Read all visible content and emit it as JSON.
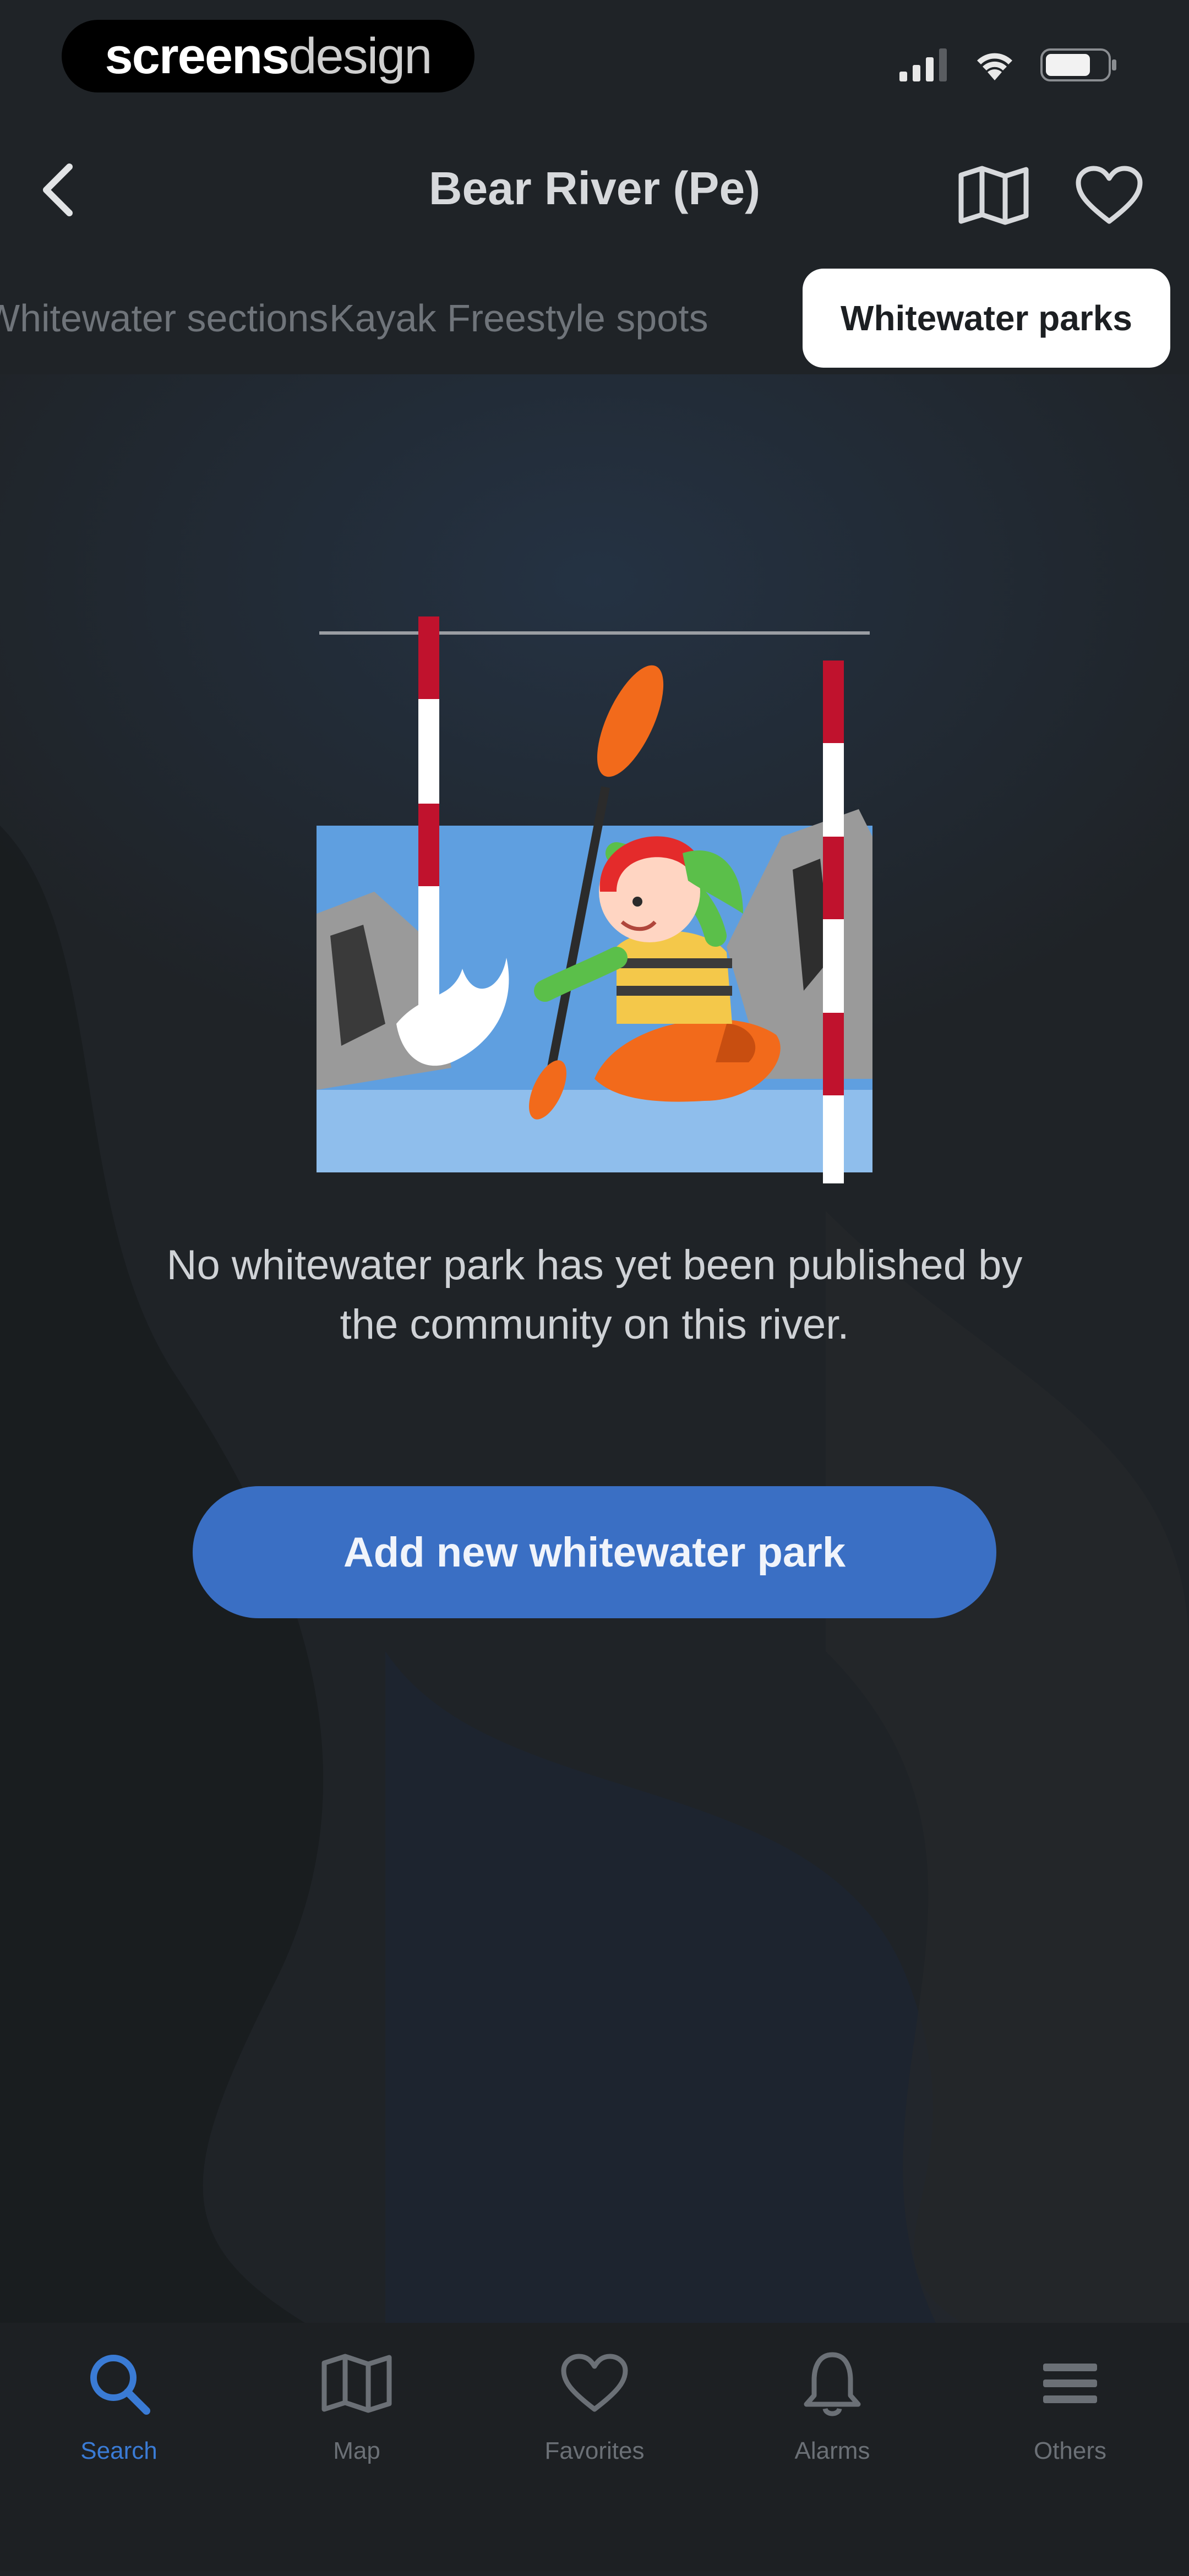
{
  "status_bar": {
    "watermark_part1": "screens",
    "watermark_part2": "design"
  },
  "header": {
    "title": "Bear River (Pe)"
  },
  "tabs": [
    {
      "label": "Whitewater sections",
      "active": false
    },
    {
      "label": "Kayak Freestyle spots",
      "active": false
    },
    {
      "label": "Whitewater parks",
      "active": true
    }
  ],
  "empty_state": {
    "message": "No whitewater park has yet been published by the community on this river.",
    "button_label": "Add new whitewater park"
  },
  "bottom_nav": [
    {
      "label": "Search",
      "icon": "search-icon",
      "active": true
    },
    {
      "label": "Map",
      "icon": "map-icon",
      "active": false
    },
    {
      "label": "Favorites",
      "icon": "heart-icon",
      "active": false
    },
    {
      "label": "Alarms",
      "icon": "bell-icon",
      "active": false
    },
    {
      "label": "Others",
      "icon": "menu-icon",
      "active": false
    }
  ],
  "colors": {
    "background": "#1f2327",
    "accent": "#3a6fc4",
    "active_nav": "#3a7bd5",
    "active_tab_bg": "#ffffff"
  }
}
